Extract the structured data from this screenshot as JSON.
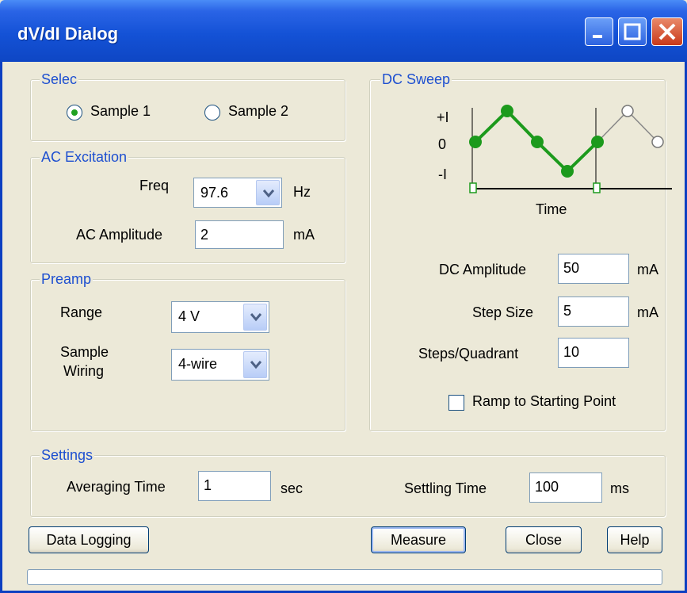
{
  "window": {
    "title": "dV/dI Dialog"
  },
  "select_group": {
    "label": "Selec",
    "sample1": "Sample 1",
    "sample2": "Sample 2",
    "selected": "Sample 1"
  },
  "ac_excitation": {
    "label": "AC Excitation",
    "freq_label": "Freq",
    "freq_value": "97.6",
    "freq_unit": "Hz",
    "amp_label": "AC Amplitude",
    "amp_value": "2",
    "amp_unit": "mA"
  },
  "preamp": {
    "label": "Preamp",
    "range_label": "Range",
    "range_value": "4 V",
    "wiring_label_1": "Sample",
    "wiring_label_2": "Wiring",
    "wiring_value": "4-wire"
  },
  "dc_sweep": {
    "label": "DC Sweep",
    "y_plus": "+I",
    "y_zero": "0",
    "y_minus": "-I",
    "x_label": "Time",
    "dc_amp_label": "DC Amplitude",
    "dc_amp_value": "50",
    "dc_amp_unit": "mA",
    "step_label": "Step Size",
    "step_value": "5",
    "step_unit": "mA",
    "steps_label": "Steps/Quadrant",
    "steps_value": "10",
    "ramp_label": "Ramp to Starting Point",
    "ramp_checked": false
  },
  "settings": {
    "label": "Settings",
    "avg_label": "Averaging Time",
    "avg_value": "1",
    "avg_unit": "sec",
    "settle_label": "Settling Time",
    "settle_value": "100",
    "settle_unit": "ms"
  },
  "buttons": {
    "data_logging": "Data Logging",
    "measure": "Measure",
    "close": "Close",
    "help": "Help"
  },
  "colors": {
    "title_bar": "#1452d6",
    "group_label": "#1d4fd0",
    "plot_green": "#1c9a1c"
  }
}
